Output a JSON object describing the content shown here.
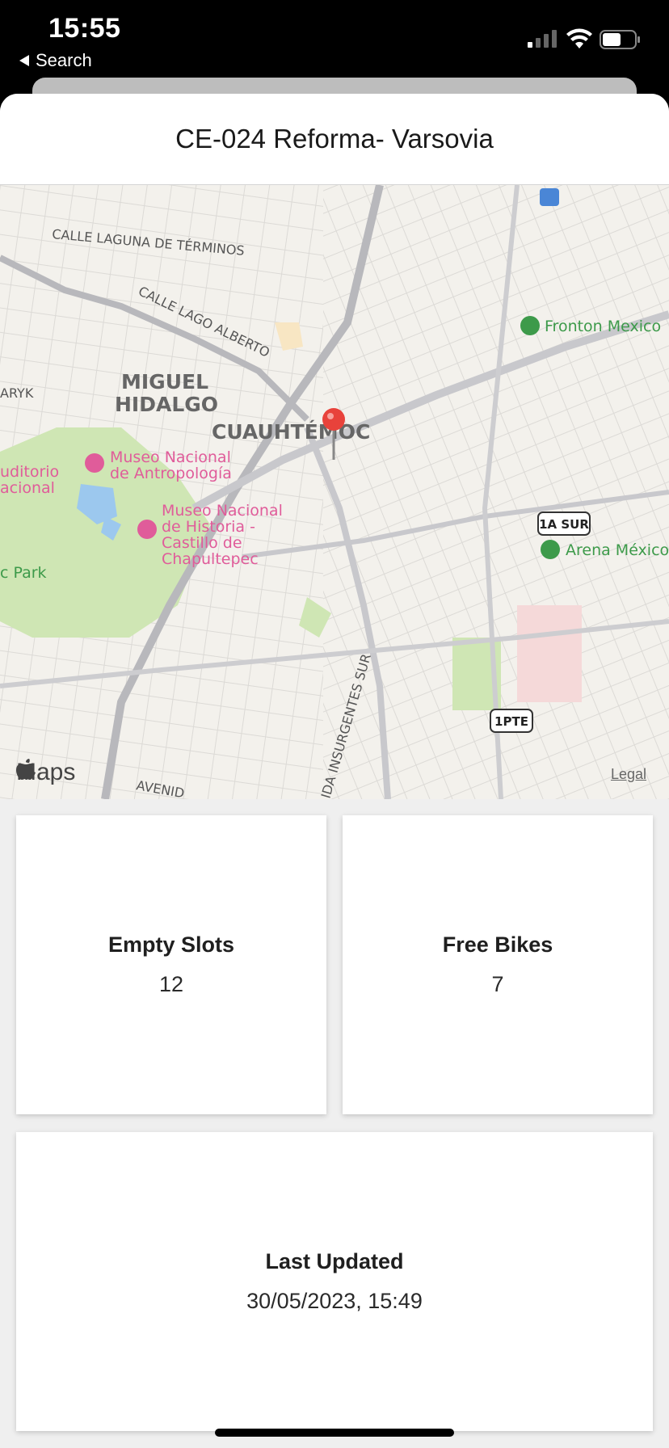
{
  "status_bar": {
    "time": "15:55",
    "back_label": "Search"
  },
  "station": {
    "title": "CE-024 Reforma- Varsovia"
  },
  "map": {
    "labels": {
      "calle_laguna": "CALLE LAGUNA DE TÉRMINOS",
      "calle_lago": "CALLE LAGO ALBERTO",
      "miguel": "MIGUEL",
      "hidalgo": "HIDALGO",
      "cuauhtemoc": "CUAUHTÉMOC",
      "aryk": "ARYK",
      "museo_antro_1": "Museo Nacional",
      "museo_antro_2": "de Antropología",
      "auditorio_1": "uditorio",
      "auditorio_2": "acional",
      "museo_hist_1": "Museo Nacional",
      "museo_hist_2": "de Historia -",
      "museo_hist_3": "Castillo de",
      "museo_hist_4": "Chapultepec",
      "park": "c Park",
      "fronton": "Fronton Mexico",
      "arena": "Arena México",
      "shield_1a": "1A SUR",
      "shield_1pte": "1PTE",
      "insurgentes": "IDA INSURGENTES SUR",
      "avenida": "AVENID"
    },
    "brand": "Maps",
    "legal": "Legal"
  },
  "cards": {
    "empty_slots": {
      "title": "Empty Slots",
      "value": "12"
    },
    "free_bikes": {
      "title": "Free Bikes",
      "value": "7"
    },
    "last_updated": {
      "title": "Last Updated",
      "value": "30/05/2023, 15:49"
    }
  },
  "colors": {
    "pin": "#e8423b",
    "poi_pink": "#e05c9a",
    "poi_green": "#3d9a4a",
    "park": "#cfe6b4",
    "water": "#9cc8ee"
  }
}
